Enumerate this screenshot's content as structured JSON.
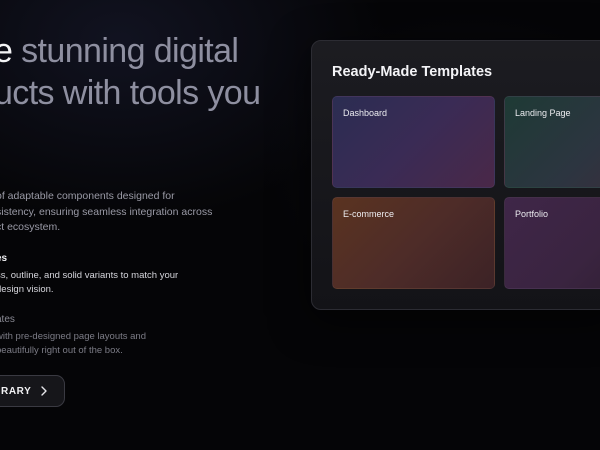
{
  "hero": {
    "title_line1_strong": "e",
    "title_line1_soft": " stunning digital",
    "title_line2": "ucts with tools you",
    "description": "of adaptable components designed for\nsistency, ensuring seamless integration across\nct ecosystem."
  },
  "features": [
    {
      "title": "es",
      "text": "ss, outline, and solid variants to match your\ndesign vision."
    },
    {
      "title": "ates",
      "text": "with pre-designed page layouts and\nbeautifully right out of the box."
    }
  ],
  "cta": {
    "label": "RARY",
    "icon": "chevron-right-icon"
  },
  "templates": {
    "title": "Ready-Made Templates",
    "items": [
      {
        "label": "Dashboard"
      },
      {
        "label": "Landing Page"
      },
      {
        "label": "E-commerce"
      },
      {
        "label": "Portfolio"
      }
    ]
  },
  "colors": {
    "background": "#050507",
    "card": "#1a1a1f",
    "text_primary": "#f4f4f6",
    "text_muted": "#8e8fa0"
  }
}
